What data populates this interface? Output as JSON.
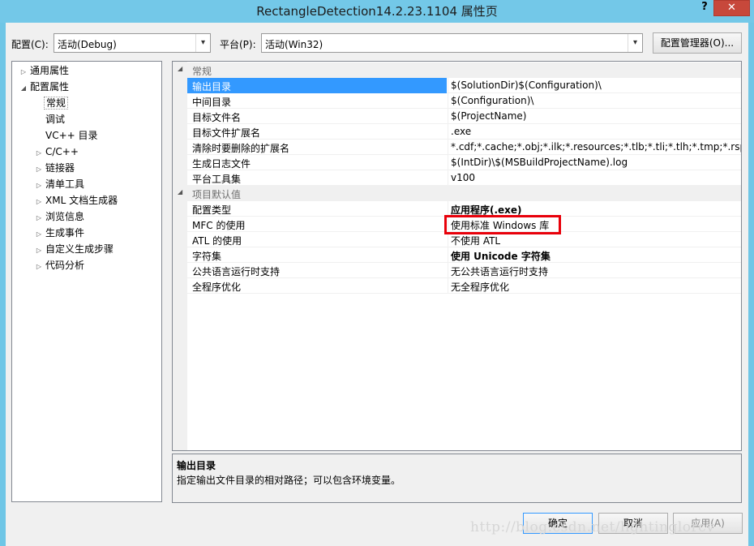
{
  "window": {
    "title": "RectangleDetection14.2.23.1104 属性页",
    "help": "?",
    "close": "✕"
  },
  "toolbar": {
    "config_label": "配置(C):",
    "config_value": "活动(Debug)",
    "platform_label": "平台(P):",
    "platform_value": "活动(Win32)",
    "config_manager": "配置管理器(O)..."
  },
  "tree": {
    "items": [
      {
        "label": "通用属性",
        "twisty": "▷"
      },
      {
        "label": "配置属性",
        "twisty": "◢"
      },
      {
        "label": "常规",
        "twisty": ""
      },
      {
        "label": "调试",
        "twisty": ""
      },
      {
        "label": "VC++ 目录",
        "twisty": ""
      },
      {
        "label": "C/C++",
        "twisty": "▷"
      },
      {
        "label": "链接器",
        "twisty": "▷"
      },
      {
        "label": "清单工具",
        "twisty": "▷"
      },
      {
        "label": "XML 文档生成器",
        "twisty": "▷"
      },
      {
        "label": "浏览信息",
        "twisty": "▷"
      },
      {
        "label": "生成事件",
        "twisty": "▷"
      },
      {
        "label": "自定义生成步骤",
        "twisty": "▷"
      },
      {
        "label": "代码分析",
        "twisty": "▷"
      }
    ]
  },
  "grid": {
    "categories": [
      {
        "label": "常规",
        "twisty": "◢"
      },
      {
        "label": "项目默认值",
        "twisty": "◢"
      }
    ],
    "general": [
      {
        "name": "输出目录",
        "value": "$(SolutionDir)$(Configuration)\\"
      },
      {
        "name": "中间目录",
        "value": "$(Configuration)\\"
      },
      {
        "name": "目标文件名",
        "value": "$(ProjectName)"
      },
      {
        "name": "目标文件扩展名",
        "value": ".exe"
      },
      {
        "name": "清除时要删除的扩展名",
        "value": "*.cdf;*.cache;*.obj;*.ilk;*.resources;*.tlb;*.tli;*.tlh;*.tmp;*.rsp;*.pgc"
      },
      {
        "name": "生成日志文件",
        "value": "$(IntDir)\\$(MSBuildProjectName).log"
      },
      {
        "name": "平台工具集",
        "value": "v100"
      }
    ],
    "defaults": [
      {
        "name": "配置类型",
        "value": "应用程序(.exe)"
      },
      {
        "name": "MFC 的使用",
        "value": "使用标准 Windows 库"
      },
      {
        "name": "ATL 的使用",
        "value": "不使用 ATL"
      },
      {
        "name": "字符集",
        "value": "使用 Unicode 字符集"
      },
      {
        "name": "公共语言运行时支持",
        "value": "无公共语言运行时支持"
      },
      {
        "name": "全程序优化",
        "value": "无全程序优化"
      }
    ],
    "dropdown_arrow": "▾"
  },
  "description": {
    "title": "输出目录",
    "text": "指定输出文件目录的相对路径；可以包含环境变量。"
  },
  "buttons": {
    "ok": "确定",
    "cancel": "取消",
    "apply": "应用(A)"
  },
  "watermark": "http://blog.csdn.net/lightinglorcv",
  "colors": {
    "selection": "#3399ff",
    "highlight_box": "#e8000a",
    "titlebar": "#73c8e8",
    "close_button": "#c7483b"
  }
}
